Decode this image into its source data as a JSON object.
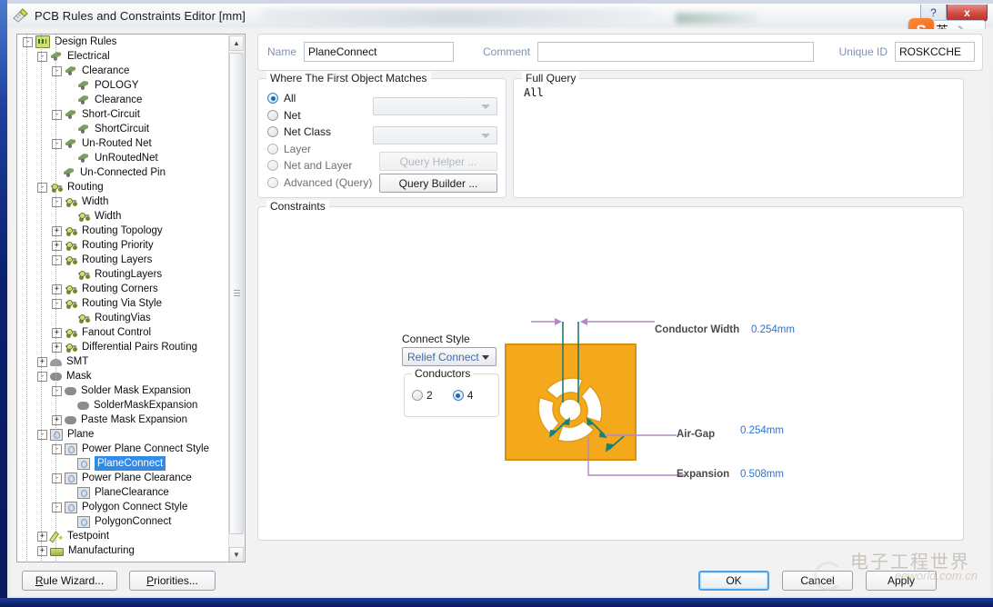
{
  "window": {
    "title": "PCB Rules and Constraints Editor [mm]",
    "icon": "pcb-ruler-icon",
    "help_label": "?",
    "close_label": "x"
  },
  "ime": {
    "logo_label": "S",
    "mode_label": "英",
    "moon_icon": "☽"
  },
  "tree": {
    "nodes": [
      {
        "label": "Design Rules",
        "depth": 0,
        "expander": "-",
        "icon": "folder-rules-icon",
        "selected": false
      },
      {
        "label": "Electrical",
        "depth": 1,
        "expander": "-",
        "icon": "electrical-icon",
        "selected": false
      },
      {
        "label": "Clearance",
        "depth": 2,
        "expander": "-",
        "icon": "electrical-icon",
        "selected": false
      },
      {
        "label": "POLOGY",
        "depth": 3,
        "expander": "",
        "icon": "electrical-icon",
        "selected": false
      },
      {
        "label": "Clearance",
        "depth": 3,
        "expander": "",
        "icon": "electrical-icon",
        "selected": false
      },
      {
        "label": "Short-Circuit",
        "depth": 2,
        "expander": "-",
        "icon": "electrical-icon",
        "selected": false
      },
      {
        "label": "ShortCircuit",
        "depth": 3,
        "expander": "",
        "icon": "electrical-icon",
        "selected": false
      },
      {
        "label": "Un-Routed Net",
        "depth": 2,
        "expander": "-",
        "icon": "electrical-icon",
        "selected": false
      },
      {
        "label": "UnRoutedNet",
        "depth": 3,
        "expander": "",
        "icon": "electrical-icon",
        "selected": false
      },
      {
        "label": "Un-Connected Pin",
        "depth": 2,
        "expander": "",
        "icon": "electrical-icon",
        "selected": false
      },
      {
        "label": "Routing",
        "depth": 1,
        "expander": "-",
        "icon": "routing-icon",
        "selected": false
      },
      {
        "label": "Width",
        "depth": 2,
        "expander": "-",
        "icon": "routing-icon",
        "selected": false
      },
      {
        "label": "Width",
        "depth": 3,
        "expander": "",
        "icon": "routing-icon",
        "selected": false
      },
      {
        "label": "Routing Topology",
        "depth": 2,
        "expander": "+",
        "icon": "routing-icon",
        "selected": false
      },
      {
        "label": "Routing Priority",
        "depth": 2,
        "expander": "+",
        "icon": "routing-icon",
        "selected": false
      },
      {
        "label": "Routing Layers",
        "depth": 2,
        "expander": "-",
        "icon": "routing-icon",
        "selected": false
      },
      {
        "label": "RoutingLayers",
        "depth": 3,
        "expander": "",
        "icon": "routing-icon",
        "selected": false
      },
      {
        "label": "Routing Corners",
        "depth": 2,
        "expander": "+",
        "icon": "routing-icon",
        "selected": false
      },
      {
        "label": "Routing Via Style",
        "depth": 2,
        "expander": "-",
        "icon": "routing-icon",
        "selected": false
      },
      {
        "label": "RoutingVias",
        "depth": 3,
        "expander": "",
        "icon": "routing-icon",
        "selected": false
      },
      {
        "label": "Fanout Control",
        "depth": 2,
        "expander": "+",
        "icon": "routing-icon",
        "selected": false
      },
      {
        "label": "Differential Pairs Routing",
        "depth": 2,
        "expander": "+",
        "icon": "routing-icon",
        "selected": false
      },
      {
        "label": "SMT",
        "depth": 1,
        "expander": "+",
        "icon": "smt-icon",
        "selected": false
      },
      {
        "label": "Mask",
        "depth": 1,
        "expander": "-",
        "icon": "mask-icon",
        "selected": false
      },
      {
        "label": "Solder Mask Expansion",
        "depth": 2,
        "expander": "-",
        "icon": "mask-icon",
        "selected": false
      },
      {
        "label": "SolderMaskExpansion",
        "depth": 3,
        "expander": "",
        "icon": "mask-icon",
        "selected": false
      },
      {
        "label": "Paste Mask Expansion",
        "depth": 2,
        "expander": "+",
        "icon": "mask-icon",
        "selected": false
      },
      {
        "label": "Plane",
        "depth": 1,
        "expander": "-",
        "icon": "plane-icon",
        "selected": false
      },
      {
        "label": "Power Plane Connect Style",
        "depth": 2,
        "expander": "-",
        "icon": "plane-icon",
        "selected": false
      },
      {
        "label": "PlaneConnect",
        "depth": 3,
        "expander": "",
        "icon": "plane-icon",
        "selected": true
      },
      {
        "label": "Power Plane Clearance",
        "depth": 2,
        "expander": "-",
        "icon": "plane-icon",
        "selected": false
      },
      {
        "label": "PlaneClearance",
        "depth": 3,
        "expander": "",
        "icon": "plane-icon",
        "selected": false
      },
      {
        "label": "Polygon Connect Style",
        "depth": 2,
        "expander": "-",
        "icon": "plane-icon",
        "selected": false
      },
      {
        "label": "PolygonConnect",
        "depth": 3,
        "expander": "",
        "icon": "plane-icon",
        "selected": false
      },
      {
        "label": "Testpoint",
        "depth": 1,
        "expander": "+",
        "icon": "testpoint-icon",
        "selected": false
      },
      {
        "label": "Manufacturing",
        "depth": 1,
        "expander": "+",
        "icon": "manufacturing-icon",
        "selected": false
      }
    ],
    "scroll_up_icon": "▲",
    "scroll_down_icon": "▼"
  },
  "header": {
    "name_label": "Name",
    "name_value": "PlaneConnect",
    "comment_label": "Comment",
    "comment_value": "",
    "unique_id_label": "Unique ID",
    "unique_id_value": "ROSKCCHE"
  },
  "where_matches": {
    "title": "Where The First Object Matches",
    "options": [
      {
        "label": "All",
        "selected": true
      },
      {
        "label": "Net",
        "selected": false
      },
      {
        "label": "Net Class",
        "selected": false
      },
      {
        "label": "Layer",
        "selected": false
      },
      {
        "label": "Net and Layer",
        "selected": false
      },
      {
        "label": "Advanced (Query)",
        "selected": false
      }
    ],
    "net_combo_value": "",
    "net_class_combo_value": "",
    "query_helper_label": "Query Helper ...",
    "query_builder_label": "Query Builder ..."
  },
  "full_query": {
    "title": "Full Query",
    "text": "All"
  },
  "constraints": {
    "title": "Constraints",
    "connect_style_label": "Connect Style",
    "connect_style_value": "Relief Connect",
    "conductors_label": "Conductors",
    "conductors_options": [
      {
        "label": "2",
        "selected": false
      },
      {
        "label": "4",
        "selected": true
      }
    ],
    "annotations": [
      {
        "label": "Conductor Width",
        "value": "0.254mm"
      },
      {
        "label": "Air-Gap",
        "value": "0.254mm"
      },
      {
        "label": "Expansion",
        "value": "0.508mm"
      }
    ],
    "pad_color": "#F4A81B",
    "accent_color": "#2673d6",
    "arrow_color": "#b08ac0"
  },
  "buttons": {
    "rule_wizard": "Rule Wizard...",
    "priorities": "Priorities...",
    "ok": "OK",
    "cancel": "Cancel",
    "apply": "Apply"
  },
  "watermark": {
    "cn": "电子工程世界",
    "en": "eeworld.com.cn"
  }
}
